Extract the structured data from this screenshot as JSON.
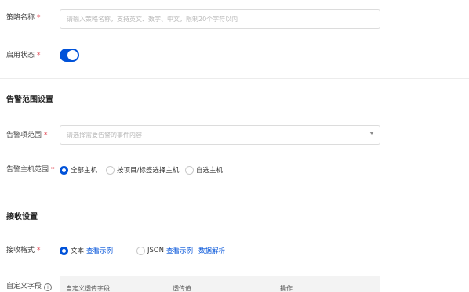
{
  "basic": {
    "policy_name_label": "策略名称",
    "policy_name_placeholder": "请输入策略名称，支持英文、数字、中文，限制20个字符以内",
    "enable_label": "启用状态",
    "required_mark": "*"
  },
  "alert_scope": {
    "title": "告警范围设置",
    "item_range_label": "告警项范围",
    "item_range_placeholder": "请选择需要告警的事件内容",
    "host_range_label": "告警主机范围",
    "host_options": [
      "全部主机",
      "按项目/标签选择主机",
      "自选主机"
    ],
    "host_selected": "全部主机"
  },
  "receive": {
    "title": "接收设置",
    "format_label": "接收格式",
    "format_text": "文本",
    "format_text_link": "查看示例",
    "format_json": "JSON",
    "format_json_link": "查看示例",
    "format_json_parse": "数据解析",
    "format_selected": "文本",
    "custom_field_label": "自定义字段",
    "info_icon_glyph": "i",
    "table_headers": [
      "自定义透传字段",
      "透传值",
      "操作"
    ]
  },
  "colors": {
    "primary": "#0052d9",
    "required": "#e34d59"
  }
}
